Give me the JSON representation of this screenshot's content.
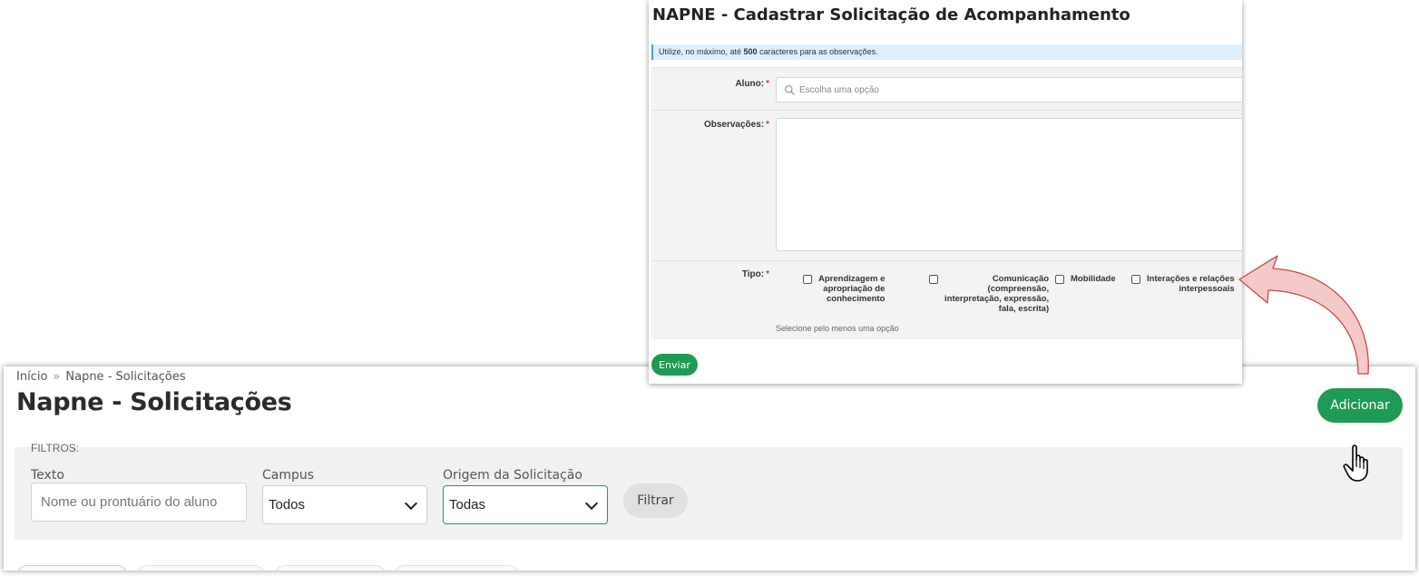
{
  "main": {
    "breadcrumb": {
      "home": "Início",
      "separator": "»",
      "current": "Napne - Solicitações"
    },
    "title": "Napne - Solicitações",
    "add_button": "Adicionar",
    "filters": {
      "heading": "FILTROS:",
      "texto_label": "Texto",
      "texto_placeholder": "Nome ou prontuário do aluno",
      "campus_label": "Campus",
      "campus_value": "Todos",
      "origem_label": "Origem da Solicitação",
      "origem_value": "Todas",
      "filter_button": "Filtrar"
    }
  },
  "modal": {
    "title": "NAPNE - Cadastrar Solicitação de Acompanhamento",
    "info_prefix": "Utilize, no máximo, até ",
    "info_bold": "500",
    "info_suffix": " caracteres para as observações.",
    "aluno_label": "Aluno:",
    "aluno_placeholder": "Escolha uma opção",
    "observacoes_label": "Observações:",
    "tipo_label": "Tipo:",
    "required_mark": "*",
    "tipo_options": [
      {
        "lines": [
          "Aprendizagem e",
          "apropriação de",
          "conhecimento"
        ]
      },
      {
        "lines": [
          "Comunicação",
          "(compreensão,",
          "interpretação, expressão,",
          "fala, escrita)"
        ]
      },
      {
        "lines": [
          "Mobilidade"
        ]
      },
      {
        "lines": [
          "Interações e relações",
          "interpessoais"
        ]
      }
    ],
    "tipo_helper": "Selecione pelo menos uma opção",
    "submit_button": "Enviar"
  },
  "colors": {
    "primary_green": "#1f9a55",
    "callout_fill": "#f6c9c9",
    "callout_stroke": "#c24b4b",
    "info_bar": "#dcefff"
  },
  "icons": [
    "search-icon",
    "chevron-down-icon",
    "checkbox-icon",
    "hand-pointer-icon",
    "curved-arrow-icon"
  ]
}
